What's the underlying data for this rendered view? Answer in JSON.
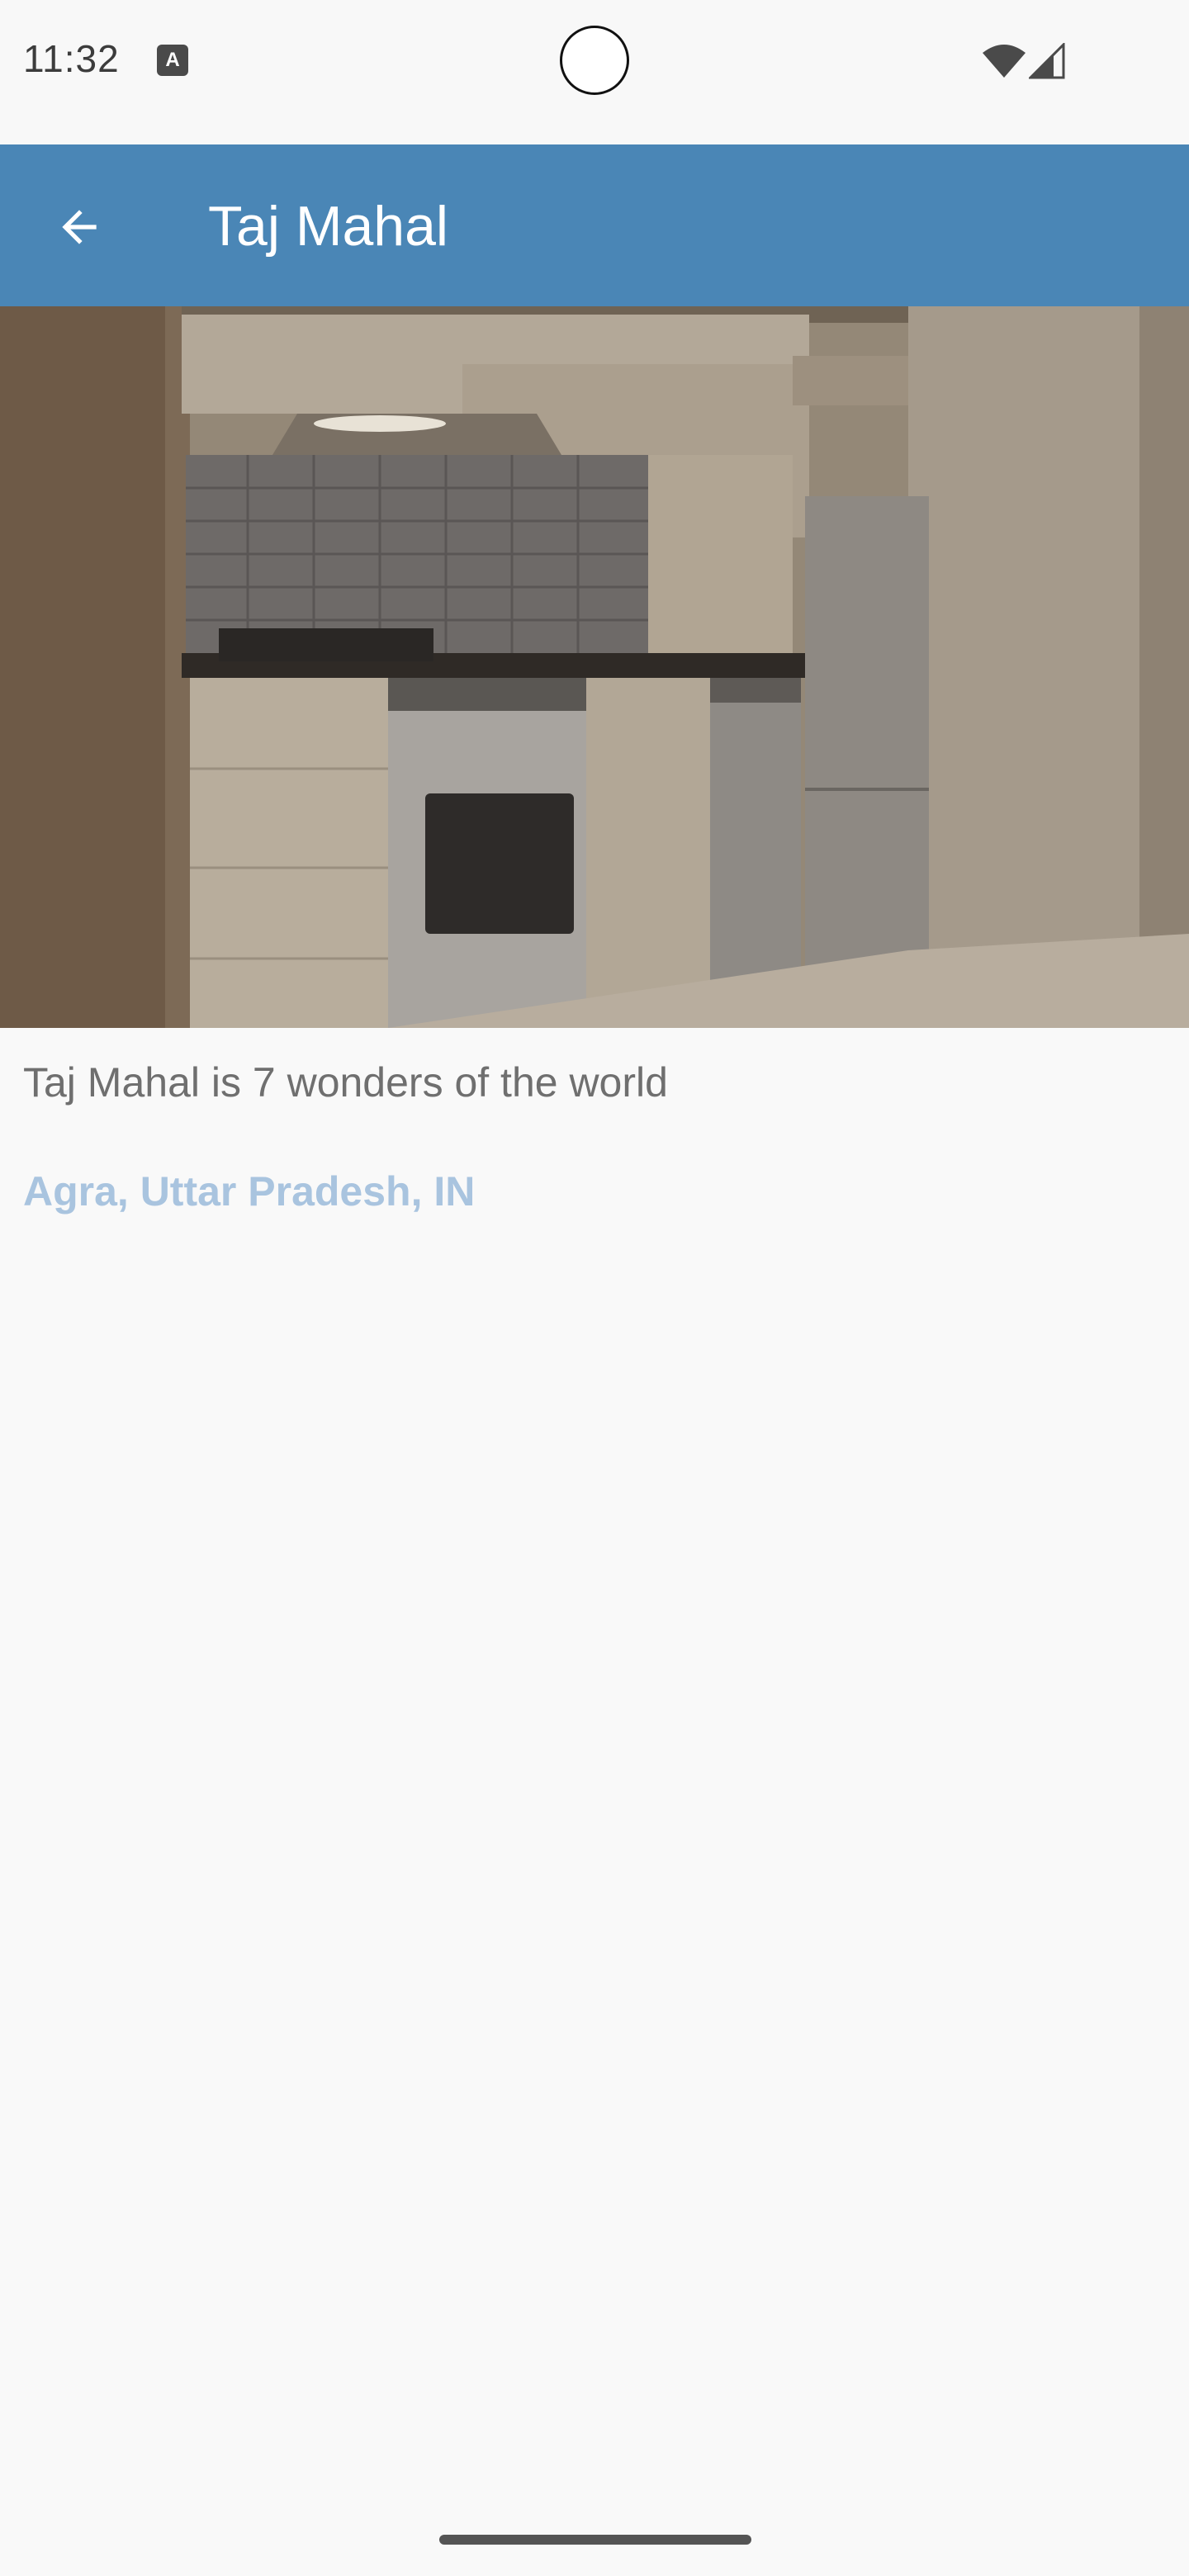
{
  "status_bar": {
    "time": "11:32",
    "notification_icon": "a-icon",
    "wifi_icon": "wifi-icon",
    "signal_icon": "signal-icon"
  },
  "app_bar": {
    "title": "Taj Mahal",
    "back_icon": "arrow-back-icon",
    "background_color": "#4a86b6"
  },
  "content": {
    "description": "Taj Mahal is 7 wonders of the world",
    "location": "Agra, Uttar Pradesh, IN",
    "location_color": "#a9c4df"
  }
}
